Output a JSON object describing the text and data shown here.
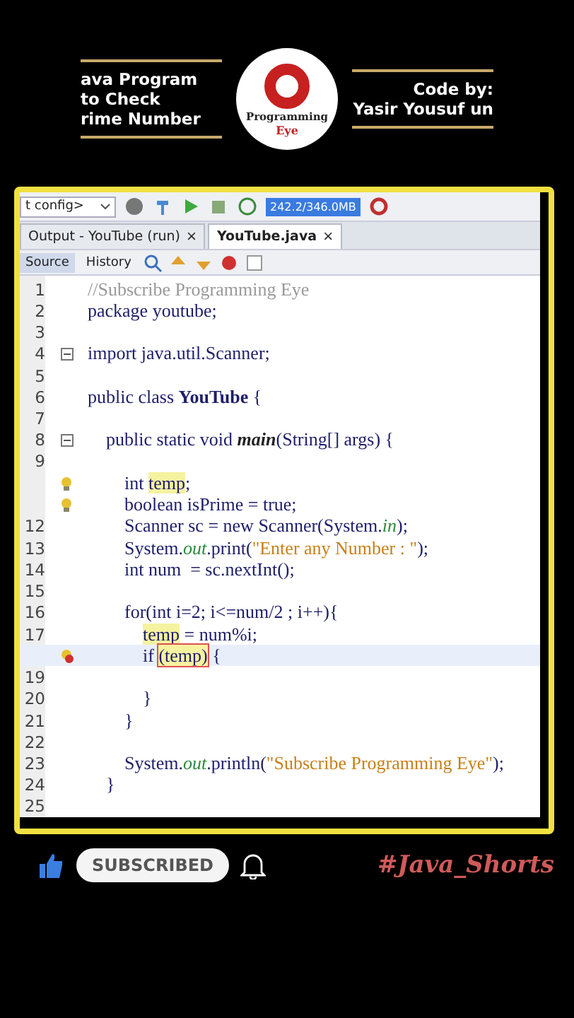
{
  "header": {
    "left_lines": [
      "ava Program",
      "to Check",
      "rime Number"
    ],
    "logo": {
      "name": "Programming",
      "sub": "Eye"
    },
    "right_lines": [
      "Code by:",
      "Yasir Yousuf un"
    ]
  },
  "toolbar": {
    "config": "t config>",
    "memory": "242.2/346.0MB"
  },
  "tabs": [
    {
      "label": "Output - YouTube (run)",
      "close": "×",
      "selected": false
    },
    {
      "label": "YouTube.java",
      "close": "×",
      "selected": true
    }
  ],
  "view_tabs": [
    {
      "label": "Source",
      "selected": true
    },
    {
      "label": "History",
      "selected": false
    }
  ],
  "code": [
    {
      "number": "1",
      "kind": "plain",
      "current": false,
      "segments": [
        {
          "text": "//Subscribe Programming Eye",
          "kind": "comment"
        }
      ]
    },
    {
      "number": "2",
      "kind": "plain",
      "current": false,
      "segments": [
        {
          "text": "package youtube;",
          "kind": "plain"
        }
      ]
    },
    {
      "number": "3",
      "kind": "plain",
      "current": false
    },
    {
      "number": "4",
      "kind": "fold",
      "current": false,
      "segments": [
        {
          "text": "import java.util.Scanner;",
          "kind": "plain"
        }
      ]
    },
    {
      "number": "5",
      "kind": "plain",
      "current": false
    },
    {
      "number": "6",
      "kind": "plain",
      "current": false,
      "segments": [
        {
          "text": "public class ",
          "kind": "plain"
        },
        {
          "text": "YouTube",
          "kind": "bold"
        },
        {
          "text": " {",
          "kind": "plain"
        }
      ]
    },
    {
      "number": "7",
      "kind": "plain",
      "current": false
    },
    {
      "number": "8",
      "kind": "fold",
      "current": false,
      "segments": [
        {
          "text": "    public static void ",
          "kind": "plain"
        },
        {
          "text": "main",
          "kind": "italic"
        },
        {
          "text": "(String[] args) {",
          "kind": "plain"
        }
      ]
    },
    {
      "number": "9",
      "kind": "plain",
      "current": false
    },
    {
      "kind": "warning",
      "current": false,
      "segments": [
        {
          "text": "        int ",
          "kind": "plain"
        },
        {
          "text": "temp",
          "kind": "mark"
        },
        {
          "text": ";",
          "kind": "plain"
        }
      ]
    },
    {
      "kind": "warning",
      "current": false,
      "segments": [
        {
          "text": "        boolean isPrime = true;",
          "kind": "plain"
        }
      ]
    },
    {
      "number": "12",
      "kind": "plain",
      "current": false,
      "segments": [
        {
          "text": "        Scanner sc = new Scanner(System.",
          "kind": "plain"
        },
        {
          "text": "in",
          "kind": "field"
        },
        {
          "text": ");",
          "kind": "plain"
        }
      ]
    },
    {
      "number": "13",
      "kind": "plain",
      "current": false,
      "segments": [
        {
          "text": "        System.",
          "kind": "plain"
        },
        {
          "text": "out",
          "kind": "field"
        },
        {
          "text": ".print(",
          "kind": "plain"
        },
        {
          "text": "\"Enter any Number : \"",
          "kind": "string"
        },
        {
          "text": ");",
          "kind": "plain"
        }
      ]
    },
    {
      "number": "14",
      "kind": "plain",
      "current": false,
      "segments": [
        {
          "text": "        int num  = sc.nextInt();",
          "kind": "plain"
        }
      ]
    },
    {
      "number": "15",
      "kind": "plain",
      "current": false
    },
    {
      "number": "16",
      "kind": "plain",
      "current": false,
      "segments": [
        {
          "text": "        for(int i=2; i<=num/2 ; i++){",
          "kind": "plain"
        }
      ]
    },
    {
      "number": "17",
      "kind": "plain",
      "current": false,
      "segments": [
        {
          "text": "            temp",
          "kind": "mark"
        },
        {
          "text": " = num%i;",
          "kind": "plain"
        }
      ]
    },
    {
      "kind": "error",
      "current": true,
      "segments": [
        {
          "text": "            if ",
          "kind": "plain"
        },
        {
          "text": "(temp)",
          "kind": "error"
        },
        {
          "text": " {",
          "kind": "plain"
        }
      ]
    },
    {
      "number": "19",
      "kind": "plain",
      "current": false
    },
    {
      "number": "20",
      "kind": "plain",
      "current": false,
      "segments": [
        {
          "text": "            }",
          "kind": "plain"
        }
      ]
    },
    {
      "number": "21",
      "kind": "plain",
      "current": false,
      "segments": [
        {
          "text": "        }",
          "kind": "plain"
        }
      ]
    },
    {
      "number": "22",
      "kind": "plain",
      "current": false
    },
    {
      "number": "23",
      "kind": "plain",
      "current": false,
      "segments": [
        {
          "text": "        System.",
          "kind": "plain"
        },
        {
          "text": "out",
          "kind": "field"
        },
        {
          "text": ".println(",
          "kind": "plain"
        },
        {
          "text": "\"Subscribe Programming Eye\"",
          "kind": "string"
        },
        {
          "text": ");",
          "kind": "plain"
        }
      ]
    },
    {
      "number": "24",
      "kind": "plain",
      "current": false,
      "segments": [
        {
          "text": "    }",
          "kind": "plain"
        }
      ]
    },
    {
      "number": "25",
      "kind": "plain",
      "current": false
    }
  ],
  "footer": {
    "subscribe": "SUBSCRIBED",
    "hashtag": "#Java_Shorts"
  }
}
